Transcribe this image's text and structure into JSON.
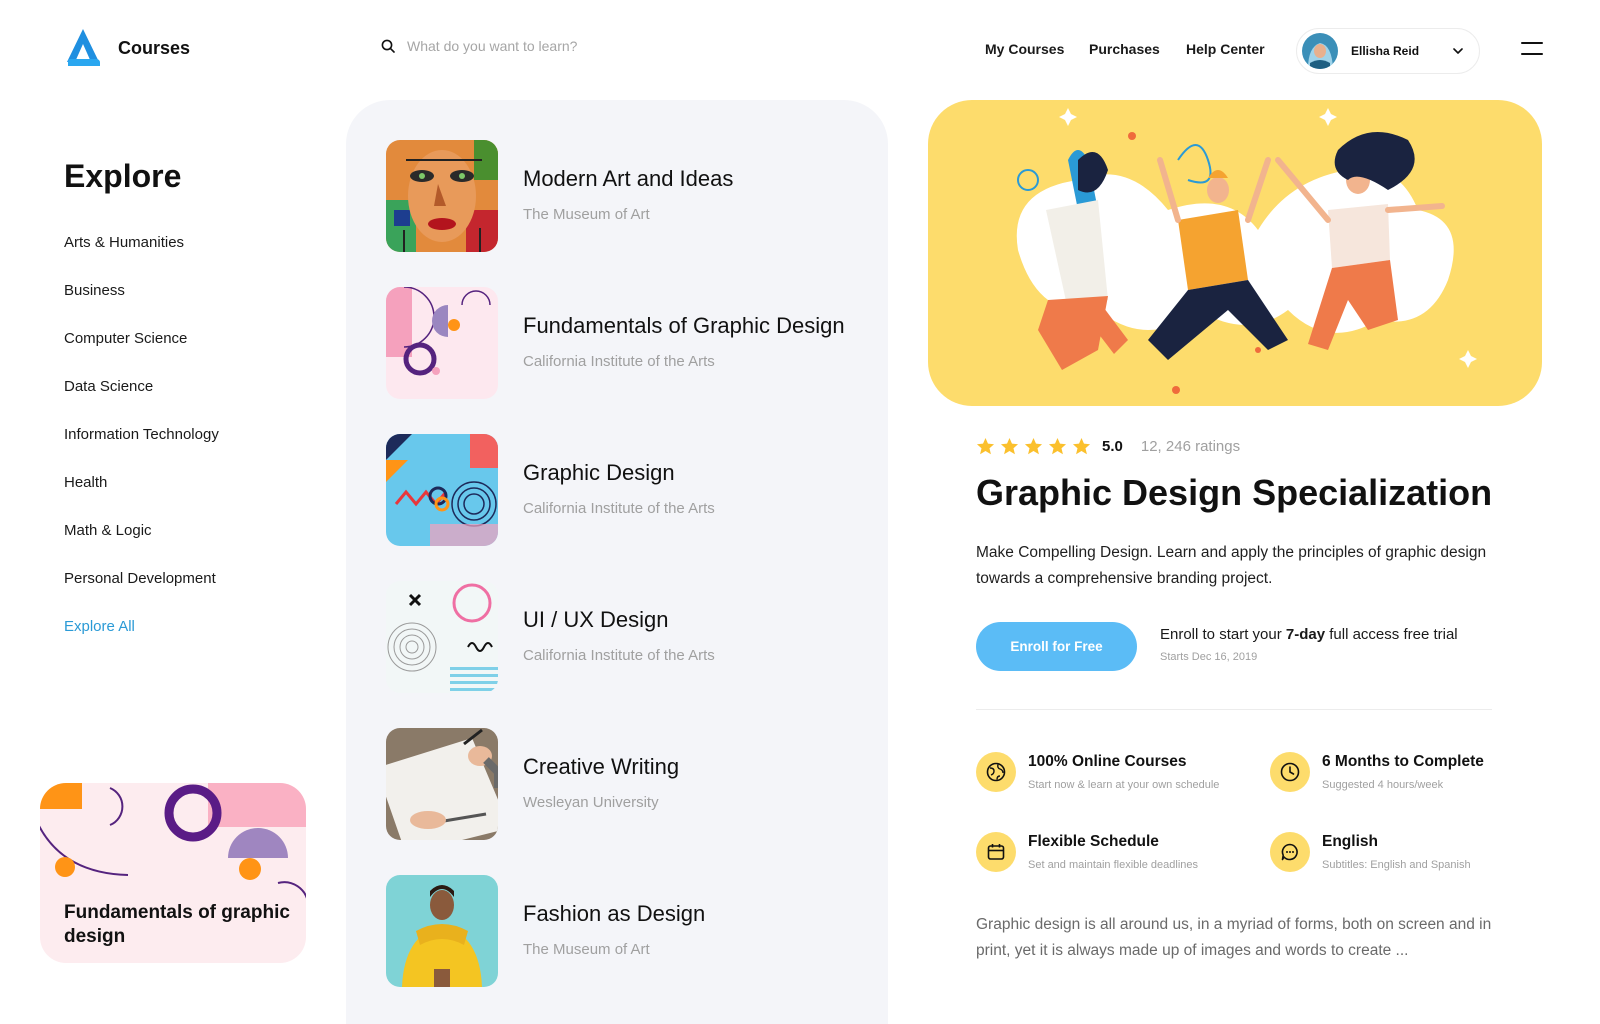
{
  "header": {
    "brand": "Courses",
    "search_placeholder": "What do you want to learn?",
    "nav": [
      "My Courses",
      "Purchases",
      "Help Center"
    ],
    "user_name": "Ellisha Reid"
  },
  "sidebar": {
    "title": "Explore",
    "categories": [
      "Arts & Humanities",
      "Business",
      "Computer Science",
      "Data Science",
      "Information Technology",
      "Health",
      "Math & Logic",
      "Personal Development",
      "Explore All"
    ],
    "promo_title": "Fundamentals of graphic design"
  },
  "courses": [
    {
      "title": "Modern Art and Ideas",
      "provider": "The Museum of Art"
    },
    {
      "title": "Fundamentals of Graphic Design",
      "provider": "California Institute of the Arts"
    },
    {
      "title": "Graphic Design",
      "provider": "California Institute of the Arts"
    },
    {
      "title": "UI / UX Design",
      "provider": "California Institute of the Arts"
    },
    {
      "title": "Creative Writing",
      "provider": "Wesleyan University"
    },
    {
      "title": "Fashion as Design",
      "provider": "The Museum of Art"
    }
  ],
  "detail": {
    "rating_value": "5.0",
    "rating_count": "12, 246 ratings",
    "stars": 5,
    "title": "Graphic Design Specialization",
    "description": "Make Compelling Design. Learn and apply the principles of graphic design towards a comprehensive branding project.",
    "enroll_label": "Enroll for Free",
    "trial_prefix": "Enroll to start your",
    "trial_bold": "7-day",
    "trial_suffix": "full access free trial",
    "starts": "Starts Dec 16, 2019",
    "features": [
      {
        "icon": "globe-icon",
        "title": "100% Online Courses",
        "subtitle": "Start now & learn at your own schedule"
      },
      {
        "icon": "clock-icon",
        "title": "6 Months to Complete",
        "subtitle": "Suggested 4 hours/week"
      },
      {
        "icon": "calendar-icon",
        "title": "Flexible Schedule",
        "subtitle": "Set and maintain flexible deadlines"
      },
      {
        "icon": "chat-icon",
        "title": "English",
        "subtitle": "Subtitles: English and Spanish"
      }
    ],
    "summary": "Graphic design is all around us, in a myriad of forms, both on screen and in print, yet it is always made up of images and words to create ..."
  },
  "colors": {
    "accent_blue": "#2a9ad6",
    "button_blue": "#5bbcf6",
    "hero_yellow": "#fddc6c",
    "panel_grey": "#f4f5f9",
    "promo_pink": "#fdecef"
  }
}
